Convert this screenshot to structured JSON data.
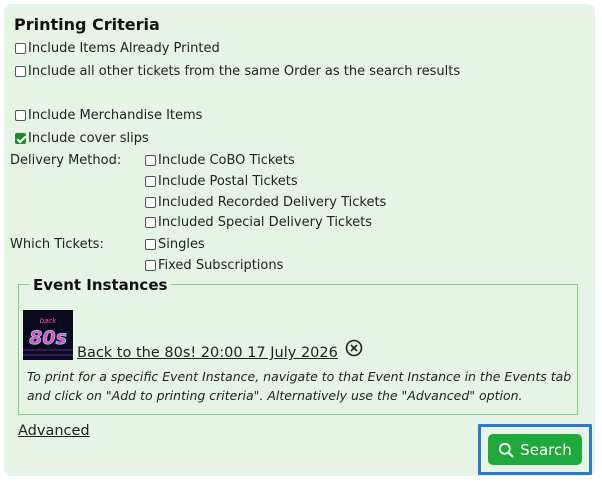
{
  "title": "Printing Criteria",
  "options": [
    {
      "label": "Include Items Already Printed",
      "checked": false
    },
    {
      "label": "Include all other tickets from the same Order as the search results",
      "checked": false
    },
    {
      "label": "Include Merchandise Items",
      "checked": false
    },
    {
      "label": "Include cover slips",
      "checked": true
    }
  ],
  "delivery": {
    "label": "Delivery Method:",
    "items": [
      {
        "label": "Include CoBO Tickets",
        "checked": false
      },
      {
        "label": "Include Postal Tickets",
        "checked": false
      },
      {
        "label": "Included Recorded Delivery Tickets",
        "checked": false
      },
      {
        "label": "Included Special Delivery Tickets",
        "checked": false
      }
    ]
  },
  "which": {
    "label": "Which Tickets:",
    "items": [
      {
        "label": "Singles",
        "checked": false
      },
      {
        "label": "Fixed Subscriptions",
        "checked": false
      }
    ]
  },
  "event_instances": {
    "legend": "Event Instances",
    "event_link": "Back to the 80s! 20:00 17 July 2026",
    "thumbnail_text": "80s",
    "help_text": "To print for a specific Event Instance, navigate to that Event Instance in the Events tab and click on \"Add to printing criteria\". Alternatively use the \"Advanced\" option."
  },
  "advanced_link": "Advanced",
  "search_button": "Search",
  "colors": {
    "panel": "#e6f4e6",
    "button": "#1fa83b",
    "highlight": "#2c7bc6"
  }
}
